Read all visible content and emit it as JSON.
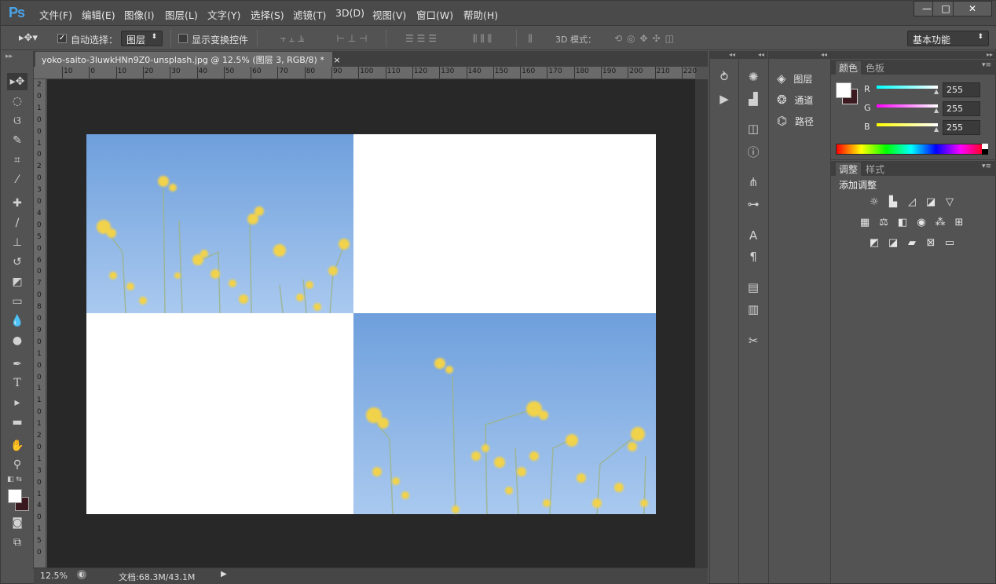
{
  "app": {
    "logo": "Ps"
  },
  "menus": [
    "文件(F)",
    "编辑(E)",
    "图像(I)",
    "图层(L)",
    "文字(Y)",
    "选择(S)",
    "滤镜(T)",
    "3D(D)",
    "视图(V)",
    "窗口(W)",
    "帮助(H)"
  ],
  "window": {
    "minimize": "—",
    "maximize": "□",
    "close": "✕"
  },
  "options": {
    "auto_select_label": "自动选择：",
    "auto_select_checked": "✓",
    "target": "图层",
    "show_transform": "显示变换控件",
    "mode_3d": "3D 模式：",
    "workspace": "基本功能"
  },
  "document": {
    "tab_title": "yoko-saito-3luwkHNn9Z0-unsplash.jpg @ 12.5% (图层 3, RGB/8) *",
    "close": "×"
  },
  "ruler": {
    "h_labels": [
      "10",
      "0",
      "10",
      "20",
      "30",
      "40",
      "50",
      "60",
      "70",
      "80",
      "90",
      "100",
      "110",
      "120",
      "130",
      "140",
      "150",
      "160",
      "170",
      "180",
      "190",
      "200",
      "210",
      "220"
    ],
    "v_labels": [
      "2",
      "0",
      "1",
      "0",
      "0",
      "1",
      "0",
      "2",
      "0",
      "3",
      "0",
      "4",
      "0",
      "5",
      "0",
      "6",
      "0",
      "7",
      "0",
      "8",
      "0",
      "9",
      "0",
      "1",
      "0",
      "0",
      "1",
      "1",
      "0",
      "1",
      "2",
      "0",
      "1",
      "3",
      "0",
      "1",
      "4",
      "0",
      "1",
      "5",
      "0"
    ]
  },
  "status": {
    "zoom": "12.5%",
    "doc": "文档:68.3M/43.1M"
  },
  "panels": {
    "layers_group": [
      {
        "icon": "layers-icon",
        "label": "图层"
      },
      {
        "icon": "channels-icon",
        "label": "通道"
      },
      {
        "icon": "paths-icon",
        "label": "路径"
      }
    ],
    "color": {
      "tabs": [
        "颜色",
        "色板"
      ],
      "r_label": "R",
      "g_label": "G",
      "b_label": "B",
      "r": "255",
      "g": "255",
      "b": "255",
      "fg": "#ffffff",
      "bg": "#3b1a1f"
    },
    "adjust": {
      "tabs": [
        "调整",
        "样式"
      ],
      "title": "添加调整"
    }
  },
  "colors": {
    "sky_top": "#6e9fdc",
    "sky_bottom": "#a9c9ef",
    "flower": "#f1d24b"
  }
}
